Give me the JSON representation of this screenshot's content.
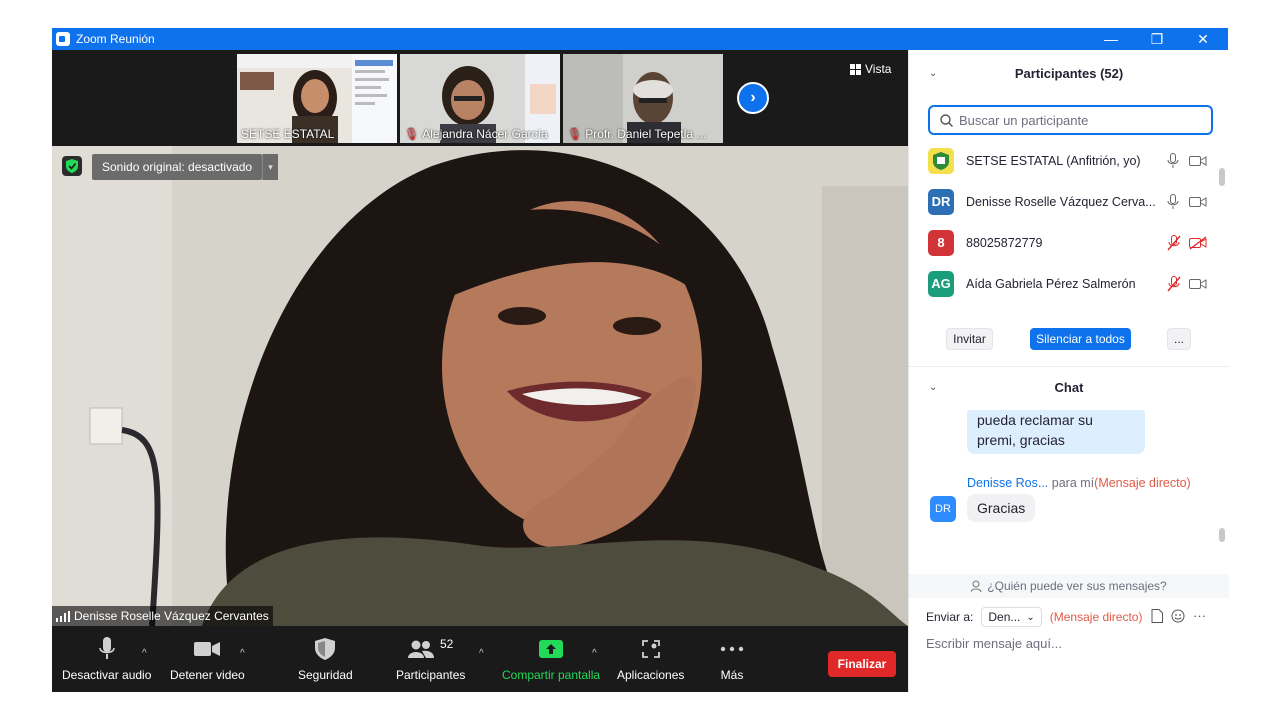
{
  "window": {
    "title": "Zoom Reunión",
    "minimize": "—",
    "restore": "❐",
    "close": "✕"
  },
  "gallery": {
    "thumbs": [
      {
        "name": "SETSE ESTATAL",
        "muted": false
      },
      {
        "name": "Alejandra Nácer García",
        "muted": true
      },
      {
        "name": "Profr. Daniel Tepetla ...",
        "muted": true
      }
    ],
    "next_glyph": "›",
    "view_label": "Vista"
  },
  "main_video": {
    "sound_label": "Sonido original: desactivado",
    "dropdown_glyph": "▾",
    "speaker_name": "Denisse Roselle Vázquez Cervantes"
  },
  "toolbar": {
    "audio_label": "Desactivar audio",
    "video_label": "Detener video",
    "security_label": "Seguridad",
    "participants_label": "Participantes",
    "participants_count": "52",
    "share_label": "Compartir pantalla",
    "apps_label": "Aplicaciones",
    "more_label": "Más",
    "end_label": "Finalizar",
    "caret": "^"
  },
  "participants_panel": {
    "title": "Participantes (52)",
    "search_placeholder": "Buscar un participante",
    "participants": [
      {
        "initials": "",
        "name": "SETSE ESTATAL (Anfitrión, yo)",
        "color": "#f4e04d",
        "mic_muted": false,
        "cam_off": false
      },
      {
        "initials": "DR",
        "name": "Denisse Roselle Vázquez Cerva...",
        "color": "#2d6fb5",
        "mic_muted": false,
        "cam_off": false
      },
      {
        "initials": "8",
        "name": "88025872779",
        "color": "#d13438",
        "mic_muted": true,
        "cam_off": true
      },
      {
        "initials": "AG",
        "name": "Aída Gabriela Pérez Salmerón",
        "color": "#1a9d7a",
        "mic_muted": true,
        "cam_off": false
      }
    ],
    "invite_label": "Invitar",
    "mute_all_label": "Silenciar a todos",
    "more_label": "..."
  },
  "chat_panel": {
    "title": "Chat",
    "previous_message": "pueda reclamar su premi, gracias",
    "sender": "Denisse Ros...",
    "to_me": "para mí",
    "dm_tag": "(Mensaje directo)",
    "sender_initials": "DR",
    "message": "Gracias",
    "who_sees": "¿Quién puede ver sus mensajes?",
    "send_to_label": "Enviar a:",
    "recipient": "Den...",
    "send_dm_tag": "(Mensaje directo)",
    "input_placeholder": "Escribir mensaje aquí..."
  },
  "colors": {
    "accent": "#0e72ed",
    "danger": "#e02828",
    "share_green": "#23d959"
  }
}
